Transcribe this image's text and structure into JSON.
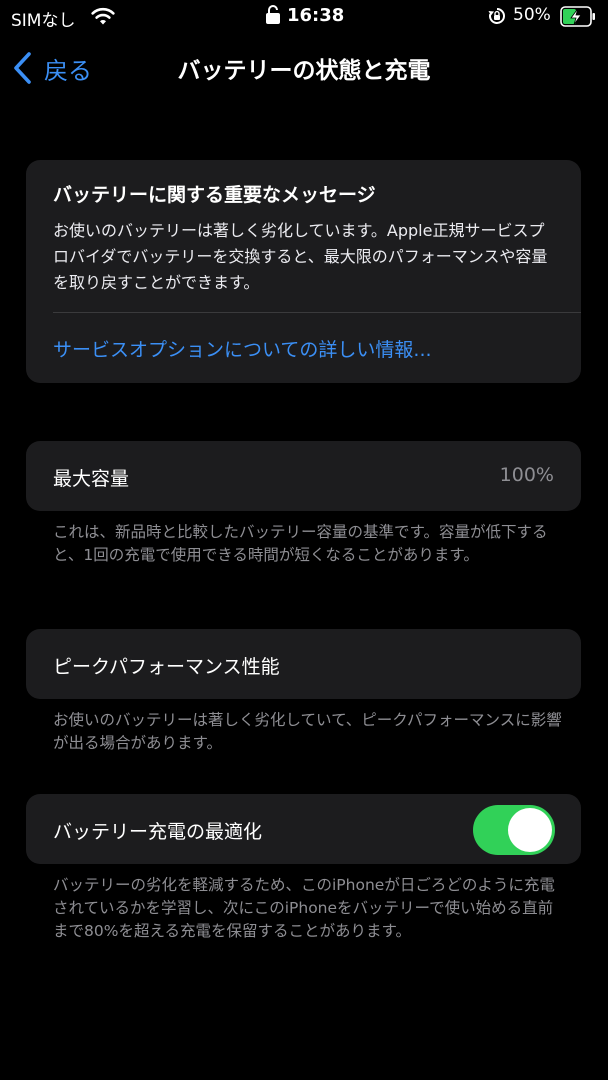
{
  "status_bar": {
    "carrier": "SIMなし",
    "time": "16:38",
    "battery_percent": "50%",
    "battery_level": 0.5,
    "charging": true,
    "icons": [
      "wifi-icon",
      "lock-icon",
      "rotation-lock-icon",
      "battery-charging-icon"
    ]
  },
  "nav": {
    "back_label": "戻る",
    "title": "バッテリーの状態と充電"
  },
  "message": {
    "heading": "バッテリーに関する重要なメッセージ",
    "body": "お使いのバッテリーは著しく劣化しています。Apple正規サービスプロバイダでバッテリーを交換すると、最大限のパフォーマンスや容量を取り戻すことができます。",
    "link": "サービスオプションについての詳しい情報..."
  },
  "capacity": {
    "label": "最大容量",
    "value": "100%",
    "note": "これは、新品時と比較したバッテリー容量の基準です。容量が低下すると、1回の充電で使用できる時間が短くなることがあります。"
  },
  "peak": {
    "label": "ピークパフォーマンス性能",
    "note": "お使いのバッテリーは著しく劣化していて、ピークパフォーマンスに影響が出る場合があります。"
  },
  "optimize": {
    "label": "バッテリー充電の最適化",
    "enabled": true,
    "note": "バッテリーの劣化を軽減するため、このiPhoneが日ごろどのように充電されているかを学習し、次にこのiPhoneをバッテリーで使い始める直前まで80%を超える充電を保留することがあります。"
  },
  "colors": {
    "background": "#000000",
    "card": "#1c1c1e",
    "accent": "#3b8ff5",
    "toggle_on": "#31d158",
    "secondary_text": "#8e8e93"
  }
}
